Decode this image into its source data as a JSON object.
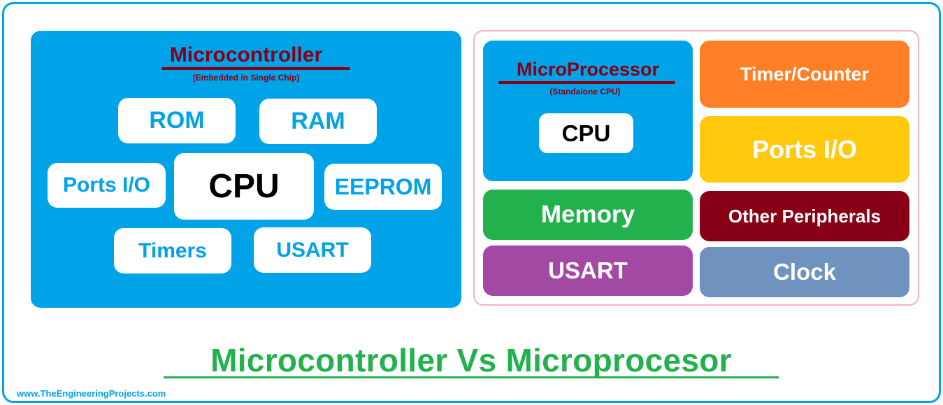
{
  "colors": {
    "frame": "#00a2e8",
    "microcontroller_panel": "#00a2e8",
    "microprocessor_border": "#ffaec9",
    "heading_text": "#880015",
    "main_title": "#22b14c"
  },
  "microcontroller": {
    "title": "Microcontroller",
    "subtitle": "(Embedded in Single Chip)",
    "components": {
      "rom": "ROM",
      "ram": "RAM",
      "ports_io": "Ports I/O",
      "cpu": "CPU",
      "eeprom": "EEPROM",
      "timers": "Timers",
      "usart": "USART"
    }
  },
  "microprocessor": {
    "title": "MicroProcessor",
    "subtitle": "(Standalone CPU)",
    "cpu": "CPU",
    "peripherals": [
      {
        "label": "Timer/Counter",
        "color": "#ff7f27"
      },
      {
        "label": "Ports I/O",
        "color": "#ffc90e"
      },
      {
        "label": "Memory",
        "color": "#22b14c"
      },
      {
        "label": "Other Peripherals",
        "color": "#880015"
      },
      {
        "label": "USART",
        "color": "#a349a4"
      },
      {
        "label": "Clock",
        "color": "#7092be"
      }
    ]
  },
  "footer": {
    "title": "Microcontroller Vs Microprocesor",
    "website": "www.TheEngineeringProjects.com"
  }
}
